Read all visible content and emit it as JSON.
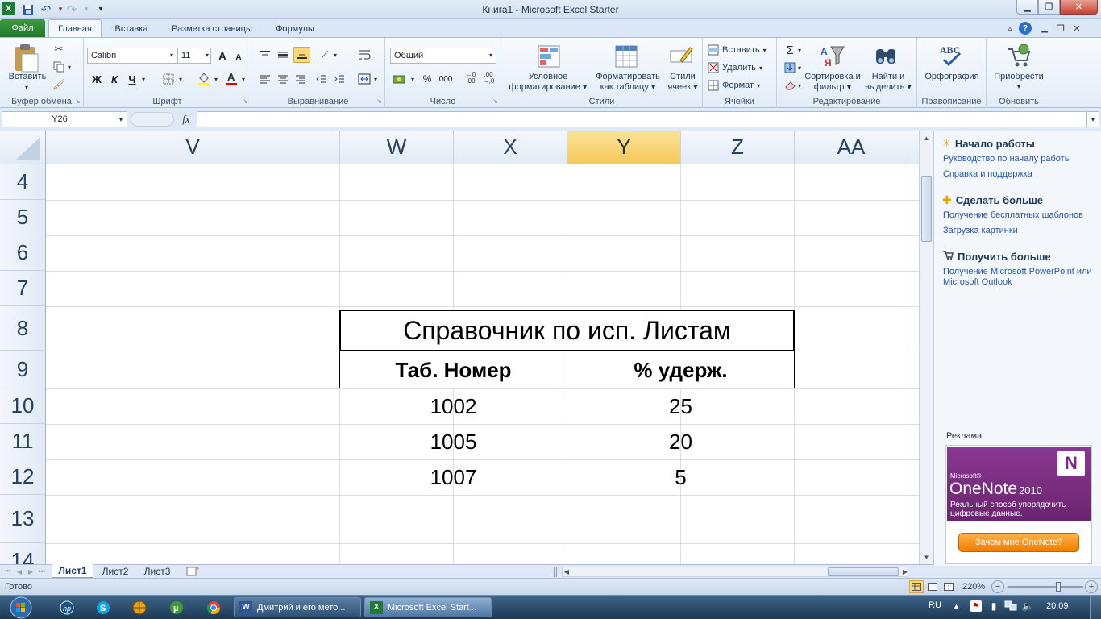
{
  "window": {
    "title": "Книга1 - Microsoft Excel Starter",
    "app_icon": "excel-icon"
  },
  "quick_access": [
    "save-icon",
    "undo-icon",
    "redo-icon",
    "customize-icon"
  ],
  "tabs": [
    {
      "label": "Файл",
      "active": false
    },
    {
      "label": "Главная",
      "active": true
    },
    {
      "label": "Вставка",
      "active": false
    },
    {
      "label": "Разметка страницы",
      "active": false
    },
    {
      "label": "Формулы",
      "active": false
    }
  ],
  "ribbon": {
    "clipboard": {
      "paste_label": "Вставить",
      "group_label": "Буфер обмена"
    },
    "font": {
      "font_name": "Calibri",
      "font_size": "11",
      "bold": "Ж",
      "italic": "К",
      "underline": "Ч",
      "grow": "A",
      "shrink": "A",
      "group_label": "Шрифт"
    },
    "alignment": {
      "group_label": "Выравнивание"
    },
    "number": {
      "format": "Общий",
      "percent": "%",
      "thousands": "000",
      "group_label": "Число"
    },
    "styles": {
      "conditional_label": "Условное форматирование",
      "table_label": "Форматировать как таблицу",
      "cell_styles_label": "Стили ячеек",
      "group_label": "Стили"
    },
    "cells": {
      "insert_label": "Вставить",
      "delete_label": "Удалить",
      "format_label": "Формат",
      "group_label": "Ячейки"
    },
    "editing": {
      "sort_label": "Сортировка и фильтр",
      "find_label": "Найти и выделить",
      "group_label": "Редактирование"
    },
    "proofing": {
      "spelling_label": "Орфография",
      "group_label": "Правописание",
      "abc": "ABC"
    },
    "update": {
      "addons_label": "Приобрести",
      "group_label": "Обновить"
    }
  },
  "formula_bar": {
    "name_box": "Y26",
    "fx": "fx",
    "formula": ""
  },
  "grid": {
    "columns": [
      {
        "label": "V",
        "selected": false
      },
      {
        "label": "W",
        "selected": false
      },
      {
        "label": "X",
        "selected": false
      },
      {
        "label": "Y",
        "selected": true
      },
      {
        "label": "Z",
        "selected": false
      },
      {
        "label": "AA",
        "selected": false
      }
    ],
    "rows": [
      "4",
      "5",
      "6",
      "7",
      "8",
      "9",
      "10",
      "11",
      "12",
      "13",
      "14"
    ],
    "table": {
      "title": "Справочник по исп. Листам",
      "headers": [
        "Таб. Номер",
        "% удерж."
      ],
      "data": [
        [
          "1002",
          "25"
        ],
        [
          "1005",
          "20"
        ],
        [
          "1007",
          "5"
        ]
      ]
    }
  },
  "sheets": [
    {
      "label": "Лист1",
      "active": true
    },
    {
      "label": "Лист2",
      "active": false
    },
    {
      "label": "Лист3",
      "active": false
    }
  ],
  "task_pane": {
    "sections": [
      {
        "heading": "Начало работы",
        "links": [
          "Руководство по началу работы",
          "Справка и поддержка"
        ]
      },
      {
        "heading": "Сделать больше",
        "links": [
          "Получение бесплатных шаблонов",
          "Загрузка картинки"
        ]
      },
      {
        "heading": "Получить больше",
        "links": [
          "Получение Microsoft PowerPoint или Microsoft Outlook"
        ]
      }
    ],
    "ad": {
      "label": "Реклама",
      "brand": "Microsoft®",
      "product": "OneNote",
      "version": "2010",
      "tagline": "Реальный способ упорядочить цифровые данные.",
      "cta": "Зачем мне OneNote?",
      "color": "#7a2d83"
    }
  },
  "status_bar": {
    "ready": "Готово",
    "zoom": "220%"
  },
  "taskbar": {
    "windows": [
      {
        "label": "Дмитрий и его мето...",
        "icon": "word-icon"
      },
      {
        "label": "Microsoft Excel Start...",
        "icon": "excel-icon"
      }
    ],
    "lang": "RU",
    "clock": "20:09"
  }
}
